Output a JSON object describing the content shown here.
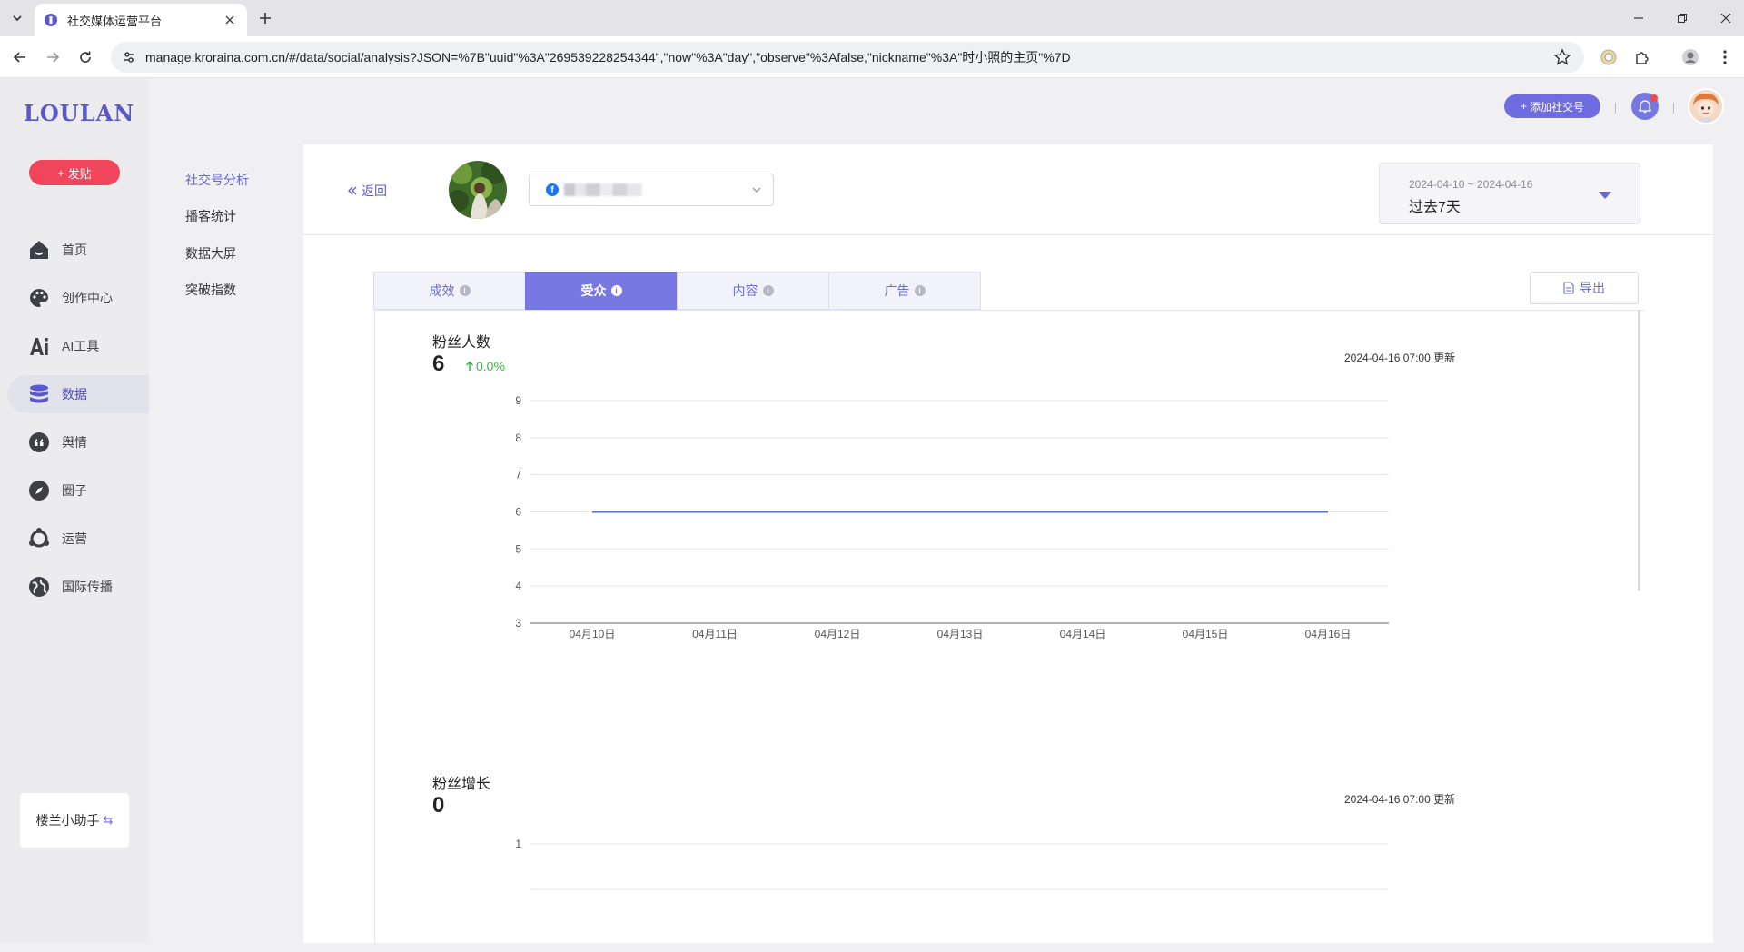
{
  "browser": {
    "tab_title": "社交媒体运营平台",
    "url": "manage.kroraina.com.cn/#/data/social/analysis?JSON=%7B\"uuid\"%3A\"269539228254344\",\"now\"%3A\"day\",\"observe\"%3Afalse,\"nickname\"%3A\"时小照的主页\"%7D"
  },
  "sidebar": {
    "logo": "LOULAN",
    "post_button": "发贴",
    "items": [
      {
        "label": "首页",
        "icon": "home-icon"
      },
      {
        "label": "创作中心",
        "icon": "palette-icon"
      },
      {
        "label": "AI工具",
        "icon": "ai-icon"
      },
      {
        "label": "数据",
        "icon": "database-icon",
        "active": true
      },
      {
        "label": "舆情",
        "icon": "quote-icon"
      },
      {
        "label": "圈子",
        "icon": "compass-icon"
      },
      {
        "label": "运营",
        "icon": "operation-icon"
      },
      {
        "label": "国际传播",
        "icon": "globe-icon"
      }
    ],
    "assistant": "楼兰小助手"
  },
  "subnav": {
    "items": [
      {
        "label": "社交号分析",
        "active": true
      },
      {
        "label": "播客统计"
      },
      {
        "label": "数据大屏"
      },
      {
        "label": "突破指数"
      }
    ]
  },
  "topbar": {
    "add_social_button": "添加社交号"
  },
  "header": {
    "back": "返回",
    "date_range": "2024-04-10 ~ 2024-04-16",
    "date_preset": "过去7天"
  },
  "tabs": [
    {
      "label": "成效"
    },
    {
      "label": "受众",
      "active": true
    },
    {
      "label": "内容"
    },
    {
      "label": "广告"
    }
  ],
  "export_button": "导出",
  "colors": {
    "accent": "#7778e2",
    "brand": "#5a57c9",
    "danger": "#f0455b",
    "line": "#4a6fd1",
    "positive": "#3cb54a"
  },
  "metrics": [
    {
      "title": "粉丝人数",
      "value": "6",
      "change": "0.0%",
      "updated": "2024-04-16 07:00 更新"
    },
    {
      "title": "粉丝增长",
      "value": "0",
      "updated": "2024-04-16 07:00 更新"
    }
  ],
  "chart_data": [
    {
      "type": "line",
      "title": "粉丝人数",
      "categories": [
        "04月10日",
        "04月11日",
        "04月12日",
        "04月13日",
        "04月14日",
        "04月15日",
        "04月16日"
      ],
      "series": [
        {
          "values": [
            6,
            6,
            6,
            6,
            6,
            6,
            6
          ]
        }
      ],
      "y_ticks": [
        3,
        4,
        5,
        6,
        7,
        8,
        9
      ],
      "ylim": [
        3,
        9
      ],
      "grid": true
    },
    {
      "type": "line",
      "title": "粉丝增长",
      "y_ticks": [
        1
      ],
      "grid": true
    }
  ]
}
